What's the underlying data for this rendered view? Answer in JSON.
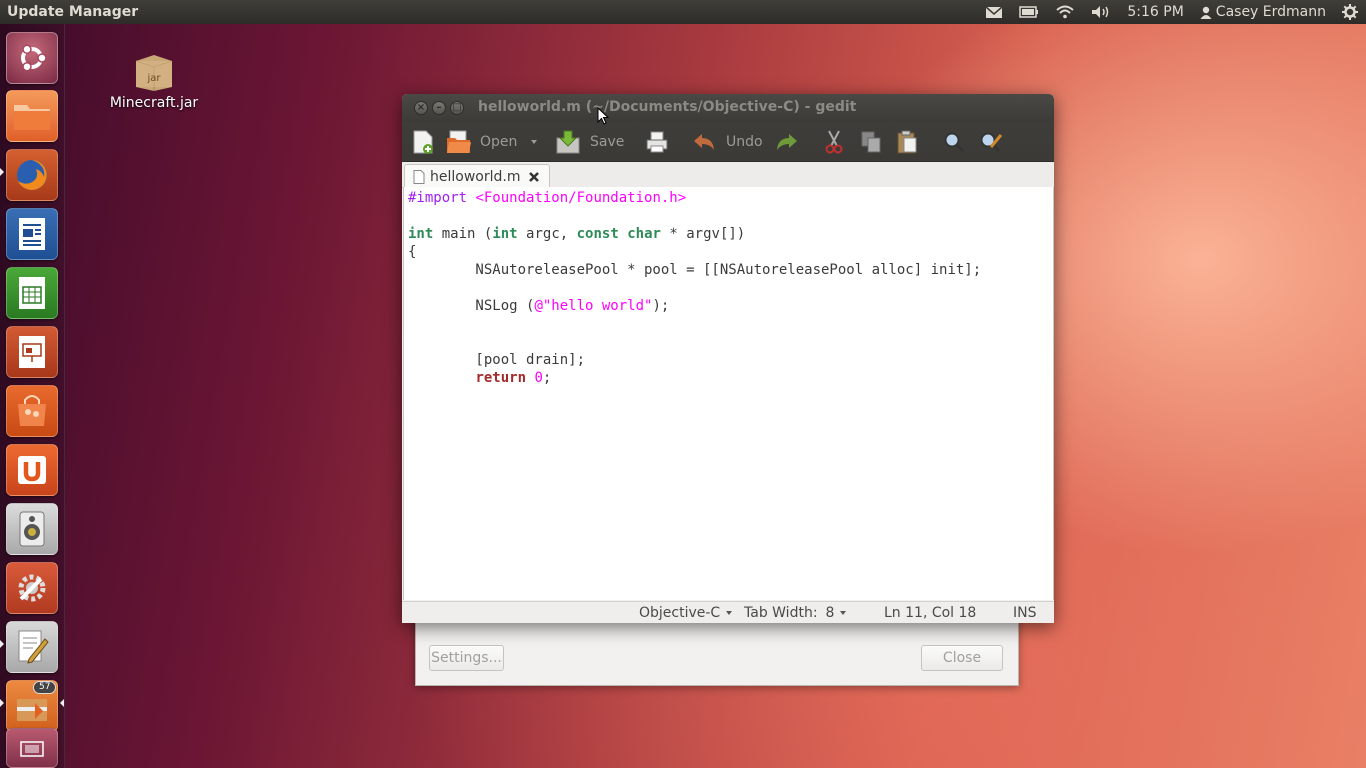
{
  "top_panel": {
    "app_title": "Update Manager",
    "clock": "5:16 PM",
    "user_name": "Casey Erdmann",
    "icons": [
      "mail-icon",
      "battery-icon",
      "wifi-icon",
      "volume-icon",
      "user-icon",
      "gear-icon"
    ]
  },
  "launcher": {
    "items": [
      "dash",
      "files",
      "firefox",
      "writer",
      "calc",
      "impress",
      "software-center",
      "ubuntu-one",
      "system-monitor",
      "system-settings",
      "gedit",
      "update-manager",
      "workspaces"
    ],
    "update_badge": "57"
  },
  "desktop": {
    "icon_label": "Minecraft.jar",
    "icon_text": "jar"
  },
  "update_manager": {
    "settings_label": "Settings...",
    "close_label": "Close"
  },
  "gedit": {
    "title": "helloworld.m (~/Documents/Objective-C) - gedit",
    "toolbar": {
      "open_label": "Open",
      "save_label": "Save",
      "undo_label": "Undo"
    },
    "tab_label": "helloworld.m",
    "code": {
      "l1_pp": "#import ",
      "l1_hdr": "<Foundation/Foundation.h>",
      "l3_int": "int",
      "l3_rest1": " main (",
      "l3_int2": "int",
      "l3_rest2": " argc, ",
      "l3_const": "const",
      "l3_sp": " ",
      "l3_char": "char",
      "l3_rest3": " * argv[])",
      "l4": "{",
      "l5": "        NSAutoreleasePool * pool = [[NSAutoreleasePool alloc] init];",
      "l7_pre": "        NSLog (",
      "l7_str": "@\"hello world\"",
      "l7_post": ");",
      "l10": "        [pool drain];",
      "l11_indent": "        ",
      "l11_kw": "return",
      "l11_sp": " ",
      "l11_num": "0",
      "l11_end": ";"
    },
    "status": {
      "language": "Objective-C",
      "tab_width_label": "Tab Width:",
      "tab_width_value": "8",
      "position": "Ln 11, Col 18",
      "mode": "INS"
    }
  },
  "colors": {
    "keyword_type": "#2e8b57",
    "keyword": "#a52a2a",
    "preprocessor": "#a020f0",
    "string": "#ff00ff",
    "panel_bg": "#3c3b37"
  }
}
